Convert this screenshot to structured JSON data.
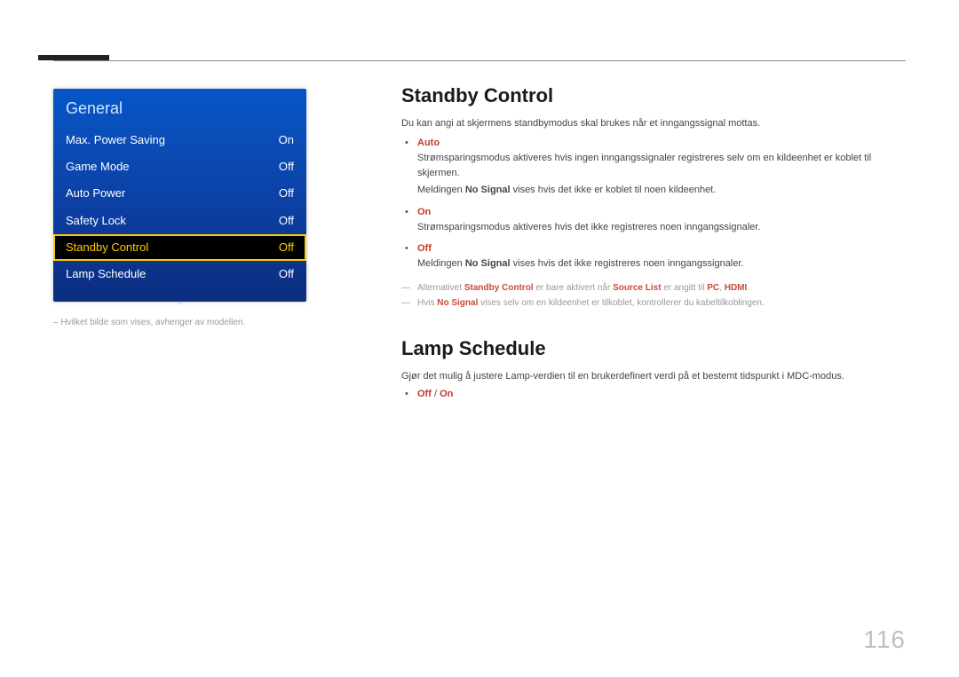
{
  "page_number": "116",
  "menu": {
    "title": "General",
    "rows": [
      {
        "label": "Max. Power Saving",
        "value": "On",
        "highlight": false
      },
      {
        "label": "Game Mode",
        "value": "Off",
        "highlight": false
      },
      {
        "label": "Auto Power",
        "value": "Off",
        "highlight": false
      },
      {
        "label": "Safety Lock",
        "value": "Off",
        "highlight": false
      },
      {
        "label": "Standby Control",
        "value": "Off",
        "highlight": true
      },
      {
        "label": "Lamp Schedule",
        "value": "Off",
        "highlight": false
      }
    ],
    "footnote": "Hvilket bilde som vises, avhenger av modellen."
  },
  "section1": {
    "title": "Standby Control",
    "intro": "Du kan angi at skjermens standbymodus skal brukes når et inngangssignal mottas.",
    "opts": {
      "auto": {
        "label": "Auto",
        "line1_a": "Strømsparingsmodus aktiveres hvis ingen inngangssignaler registreres selv om en kildeenhet er koblet til skjermen.",
        "line2_pre": "Meldingen ",
        "line2_bold": "No Signal",
        "line2_post": " vises hvis det ikke er koblet til noen kildeenhet."
      },
      "on": {
        "label": "On",
        "line": "Strømsparingsmodus aktiveres hvis det ikke registreres noen inngangssignaler."
      },
      "off": {
        "label": "Off",
        "line_pre": "Meldingen ",
        "line_bold": "No Signal",
        "line_post": " vises hvis det ikke registreres noen inngangssignaler."
      }
    },
    "notes": {
      "n1_a": "Alternativet ",
      "n1_b": "Standby Control",
      "n1_c": " er bare aktivert når ",
      "n1_d": "Source List",
      "n1_e": " er angitt til ",
      "n1_f": "PC",
      "n1_g": ", ",
      "n1_h": "HDMI",
      "n1_i": ".",
      "n2_a": "Hvis ",
      "n2_b": "No Signal",
      "n2_c": " vises selv om en kildeenhet er tilkoblet, kontrollerer du kabeltilkoblingen."
    }
  },
  "section2": {
    "title": "Lamp Schedule",
    "intro": "Gjør det mulig å justere Lamp-verdien til en brukerdefinert verdi på et bestemt tidspunkt i MDC-modus.",
    "off": "Off",
    "slash": " / ",
    "on": "On"
  }
}
